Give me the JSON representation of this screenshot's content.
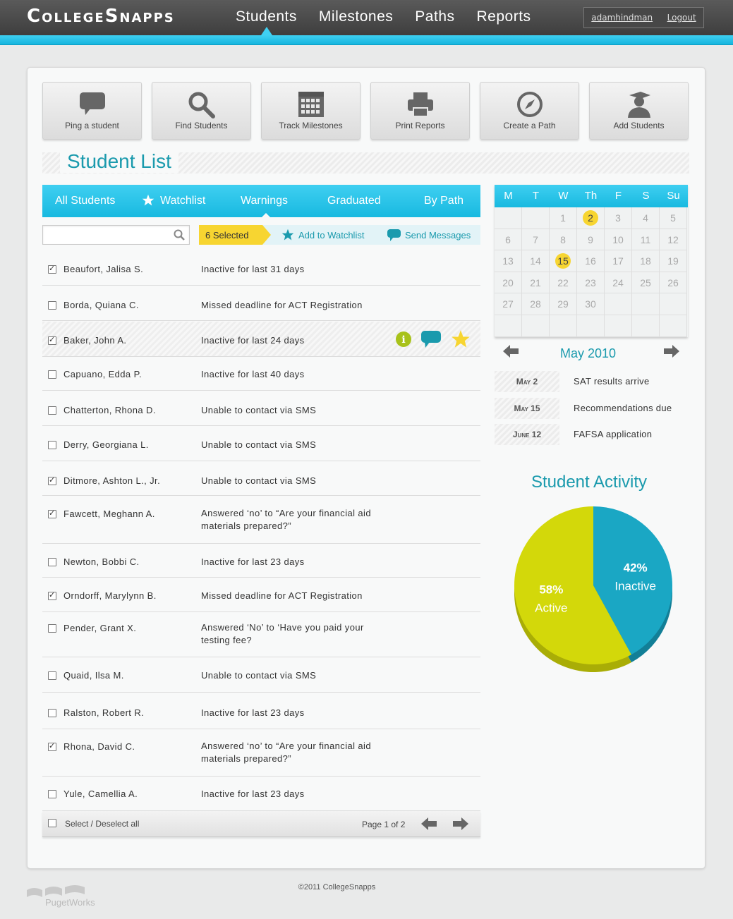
{
  "header": {
    "logo": "CollegeSnapps",
    "nav": [
      "Students",
      "Milestones",
      "Paths",
      "Reports"
    ],
    "username": "adamhindman",
    "logout": "Logout"
  },
  "actions": [
    {
      "label": "Ping a student",
      "icon": "speech-bubble-icon"
    },
    {
      "label": "Find Students",
      "icon": "magnifier-icon"
    },
    {
      "label": "Track Milestones",
      "icon": "calendar-grid-icon"
    },
    {
      "label": "Print Reports",
      "icon": "printer-icon"
    },
    {
      "label": "Create a Path",
      "icon": "compass-icon"
    },
    {
      "label": "Add Students",
      "icon": "graduate-icon"
    }
  ],
  "page_title": "Student List",
  "tabs": [
    "All Students",
    "Watchlist",
    "Warnings",
    "Graduated",
    "By Path"
  ],
  "toolbar": {
    "search_placeholder": "",
    "selected": "6 Selected",
    "add_watchlist": "Add to Watchlist",
    "send_messages": "Send Messages"
  },
  "students": [
    {
      "name": "Beaufort, Jalisa S.",
      "reason": "Inactive for last 31 days",
      "checked": true
    },
    {
      "name": "Borda, Quiana C.",
      "reason": "Missed deadline for ACT Registration",
      "checked": false
    },
    {
      "name": "Baker, John A.",
      "reason": "Inactive for last 24 days",
      "checked": true
    },
    {
      "name": "Capuano, Edda P.",
      "reason": "Inactive for last 40 days",
      "checked": false
    },
    {
      "name": "Chatterton, Rhona D.",
      "reason": "Unable to contact via SMS",
      "checked": false
    },
    {
      "name": "Derry, Georgiana L.",
      "reason": "Unable to contact via SMS",
      "checked": false
    },
    {
      "name": "Ditmore, Ashton L., Jr.",
      "reason": "Unable to contact via SMS",
      "checked": true
    },
    {
      "name": "Fawcett, Meghann A.",
      "reason": "Answered ‘no’ to “Are your financial aid materials prepared?”",
      "checked": true
    },
    {
      "name": "Newton, Bobbi C.",
      "reason": "Inactive for last 23 days",
      "checked": false
    },
    {
      "name": "Orndorff, Marylynn B.",
      "reason": "Missed deadline for ACT Registration",
      "checked": true
    },
    {
      "name": "Pender, Grant X.",
      "reason": "Answered ‘No’ to ‘Have you paid your testing fee?",
      "checked": false
    },
    {
      "name": "Quaid, Ilsa M.",
      "reason": "Unable to contact via SMS",
      "checked": false
    },
    {
      "name": "Ralston, Robert R.",
      "reason": "Inactive for last 23 days",
      "checked": false
    },
    {
      "name": "Rhona, David C.",
      "reason": "Answered ‘no’ to “Are your financial aid materials prepared?”",
      "checked": true
    },
    {
      "name": "Yule, Camellia A.",
      "reason": "Inactive for last 23 days",
      "checked": false
    }
  ],
  "list_footer": {
    "select_all": "Select / Deselect all",
    "page": "Page 1 of 2"
  },
  "calendar": {
    "weekdays": [
      "M",
      "T",
      "W",
      "Th",
      "F",
      "S",
      "Su"
    ],
    "days": [
      "",
      "",
      "",
      "",
      "",
      "",
      "",
      "",
      "",
      "1",
      "2",
      "3",
      "4",
      "5",
      "6",
      "7",
      "8",
      "9",
      "10",
      "11",
      "12",
      "13",
      "14",
      "15",
      "16",
      "17",
      "18",
      "19",
      "20",
      "21",
      "22",
      "23",
      "24",
      "25",
      "26",
      "27",
      "28",
      "29",
      "30",
      "",
      "",
      ""
    ],
    "highlighted": [
      "2",
      "15"
    ],
    "month_label": "May 2010",
    "events": [
      {
        "date": "May 2",
        "text": "SAT results arrive"
      },
      {
        "date": "May 15",
        "text": "Recommendations due"
      },
      {
        "date": "June 12",
        "text": "FAFSA application"
      }
    ]
  },
  "activity": {
    "title": "Student Activity",
    "colors": {
      "active": "#d3d80a",
      "inactive": "#1aa7c4"
    }
  },
  "chart_data": {
    "type": "pie",
    "categories": [
      "Active",
      "Inactive"
    ],
    "values": [
      58,
      42
    ],
    "labels": [
      "58%",
      "42%"
    ]
  },
  "footer": {
    "copyright": "©2011 CollegeSnapps",
    "brand": "PugetWorks"
  }
}
